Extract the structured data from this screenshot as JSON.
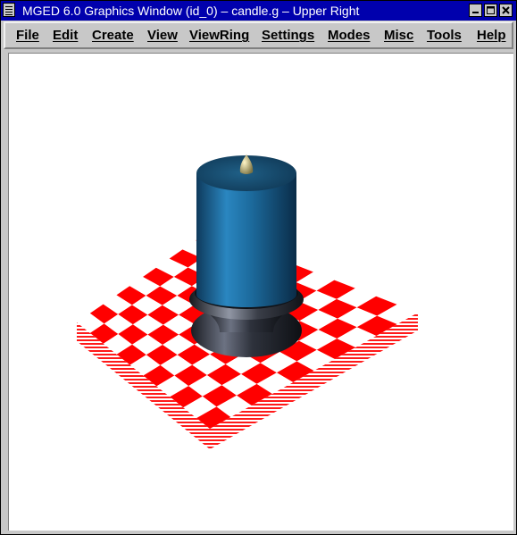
{
  "window": {
    "title": "MGED 6.0 Graphics Window (id_0) – candle.g – Upper Right"
  },
  "title_buttons": {
    "minimize_icon": "minimize-icon",
    "maximize_icon": "maximize-icon",
    "close_icon": "close-icon"
  },
  "menu": {
    "items": [
      {
        "label": "File"
      },
      {
        "label": "Edit"
      },
      {
        "label": "Create"
      },
      {
        "label": "View"
      },
      {
        "label": "ViewRing"
      },
      {
        "label": "Settings"
      },
      {
        "label": "Modes"
      },
      {
        "label": "Misc"
      },
      {
        "label": "Tools"
      },
      {
        "label": "Help"
      }
    ]
  },
  "scene": {
    "background": "#ffffff",
    "checker_colors": [
      "#ff0000",
      "#ffffff"
    ],
    "candle_color": "#1e6490",
    "holder_color": "#2a2d35",
    "wick_color": "#d8cf9a"
  },
  "colors": {
    "titlebar": "#0000ad",
    "chrome": "#c8c8c8"
  }
}
